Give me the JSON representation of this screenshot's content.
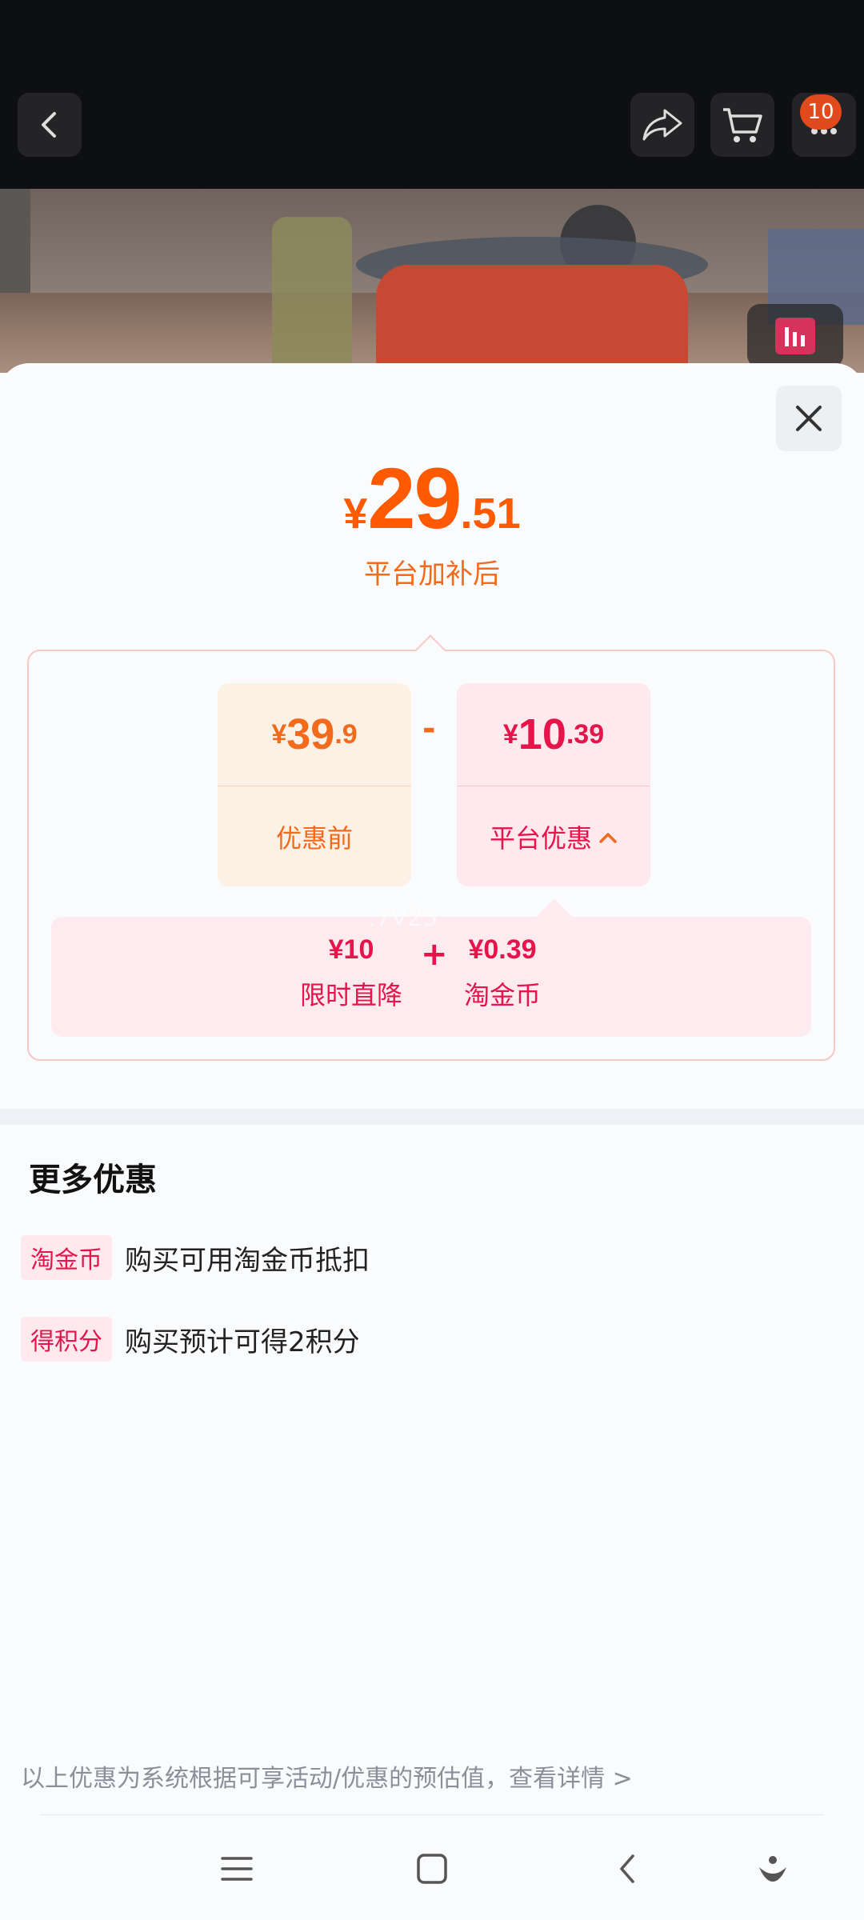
{
  "topbar": {
    "cart_badge": "10",
    "icons": [
      "back-icon",
      "share-icon",
      "cart-icon",
      "more-icon",
      "album-icon"
    ]
  },
  "summary": {
    "currency": "¥",
    "final_int": "29",
    "final_dec": ".51",
    "final_label": "平台加补后"
  },
  "calculation": {
    "original": {
      "currency": "¥",
      "int": "39",
      "dec": ".9",
      "label": "优惠前"
    },
    "operator_minus": "-",
    "discount": {
      "currency": "¥",
      "int": "10",
      "dec": ".39",
      "label": "平台优惠"
    },
    "breakdown": [
      {
        "value": "¥10",
        "name": "限时直降"
      },
      {
        "value": "¥0.39",
        "name": "淘金币"
      }
    ],
    "operator_plus": "+",
    "watermark": ".7V25"
  },
  "more_offers": {
    "title": "更多优惠",
    "items": [
      {
        "tag": "淘金币",
        "text": "购买可用淘金币抵扣"
      },
      {
        "tag": "得积分",
        "text": "购买预计可得2积分"
      }
    ]
  },
  "footnote": "以上优惠为系统根据可享活动/优惠的预估值，查看详情 >",
  "colors": {
    "price_orange": "#ff5a00",
    "discount_red": "#e6144a",
    "accent_tag_bg": "#fde9ee"
  }
}
